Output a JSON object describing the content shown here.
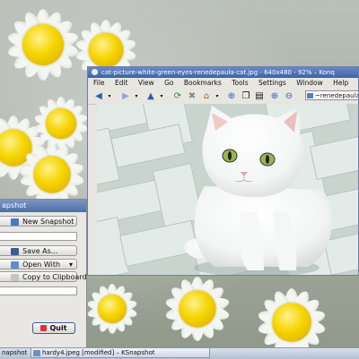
{
  "konqueror": {
    "title": "cat-picture-white-green-eyes-renedepaula-cat.jpg - 640x480 - 92% – Konq",
    "menu": [
      "File",
      "Edit",
      "View",
      "Go",
      "Bookmarks",
      "Tools",
      "Settings",
      "Window",
      "Help"
    ],
    "location": "~renedepaula"
  },
  "ksnapshot": {
    "title": "apshot",
    "new_snapshot_label": "New Snapshot",
    "save_as_label": "Save As...",
    "open_with_label": "Open With",
    "copy_label": "Copy to Clipboard",
    "quit_label": "Quit"
  },
  "taskbar": {
    "items": [
      "napshot",
      "hardy4.jpeg [modified] – KSnapshot"
    ]
  },
  "colors": {
    "accent": "#3f62a8",
    "wallpaper_daisy_center": "#f5d400"
  }
}
